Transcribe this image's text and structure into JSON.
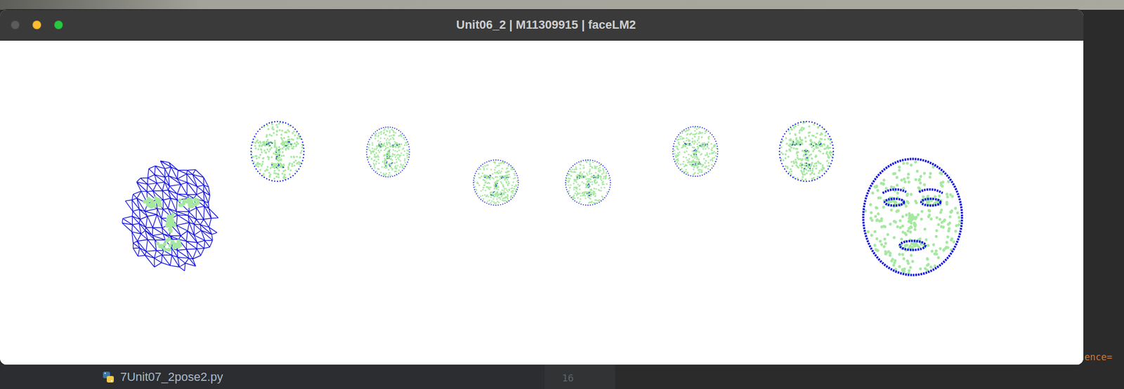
{
  "window": {
    "title": "Unit06_2 | M11309915 | faceLM2",
    "controls": [
      {
        "name": "close",
        "enabled": false
      },
      {
        "name": "minimize",
        "enabled": true
      },
      {
        "name": "zoom",
        "enabled": true
      }
    ]
  },
  "canvas": {
    "faces": [
      {
        "kind": "mesh"
      },
      {
        "kind": "points"
      },
      {
        "kind": "points"
      },
      {
        "kind": "points"
      },
      {
        "kind": "points"
      },
      {
        "kind": "points"
      },
      {
        "kind": "points"
      },
      {
        "kind": "contour"
      }
    ]
  },
  "ide": {
    "project_files": [
      {
        "name": "7Unit07_2pose2.py",
        "kind": "python"
      }
    ],
    "line_numbers": [
      "16"
    ],
    "code_fragment": "ence="
  }
}
